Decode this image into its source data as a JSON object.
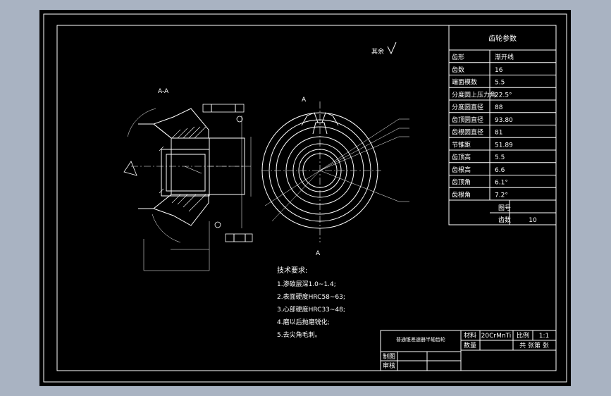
{
  "colors": {
    "background": "#a9b3c2",
    "sheet": "#000000",
    "line": "#ffffff"
  },
  "params_table": {
    "title": "齿轮参数",
    "rows": [
      {
        "label": "齿形",
        "value": "渐开线"
      },
      {
        "label": "齿数",
        "value": "16"
      },
      {
        "label": "端面模数",
        "value": "5.5"
      },
      {
        "label": "分度圆上压力角",
        "value": "22.5°"
      },
      {
        "label": "分度圆直径",
        "value": "88"
      },
      {
        "label": "齿顶圆直径",
        "value": "93.80"
      },
      {
        "label": "齿根圆直径",
        "value": "81"
      },
      {
        "label": "节锥距",
        "value": "51.89"
      },
      {
        "label": "齿顶高",
        "value": "5.5"
      },
      {
        "label": "齿根高",
        "value": "6.6"
      },
      {
        "label": "齿顶角",
        "value": "6.1°"
      },
      {
        "label": "齿根角",
        "value": "7.2°"
      }
    ],
    "mating": {
      "label1": "图号",
      "value1": "",
      "label2": "齿数",
      "value2": "10"
    }
  },
  "surface_note": "其余",
  "section_label": "A-A",
  "view_labels": {
    "top": "A",
    "bottom": "A"
  },
  "tech_requirements": {
    "title": "技术要求:",
    "items": [
      "1.渗碳层深1.0~1.4;",
      "2.表面硬度HRC58~63;",
      "3.心部硬度HRC33~48;",
      "4.磨以后抛磨锐化;",
      "5.去尖角毛刺。"
    ]
  },
  "title_block": {
    "drawing_name": "普通锥差速器半轴齿轮",
    "material_label": "材料",
    "material_value": "20CrMnTi",
    "scale_label": "比例",
    "scale_value": "1:1",
    "qty_label": "数量",
    "sheets_label": "共  张第  张",
    "drawn_label": "制图",
    "checked_label": "审核"
  }
}
